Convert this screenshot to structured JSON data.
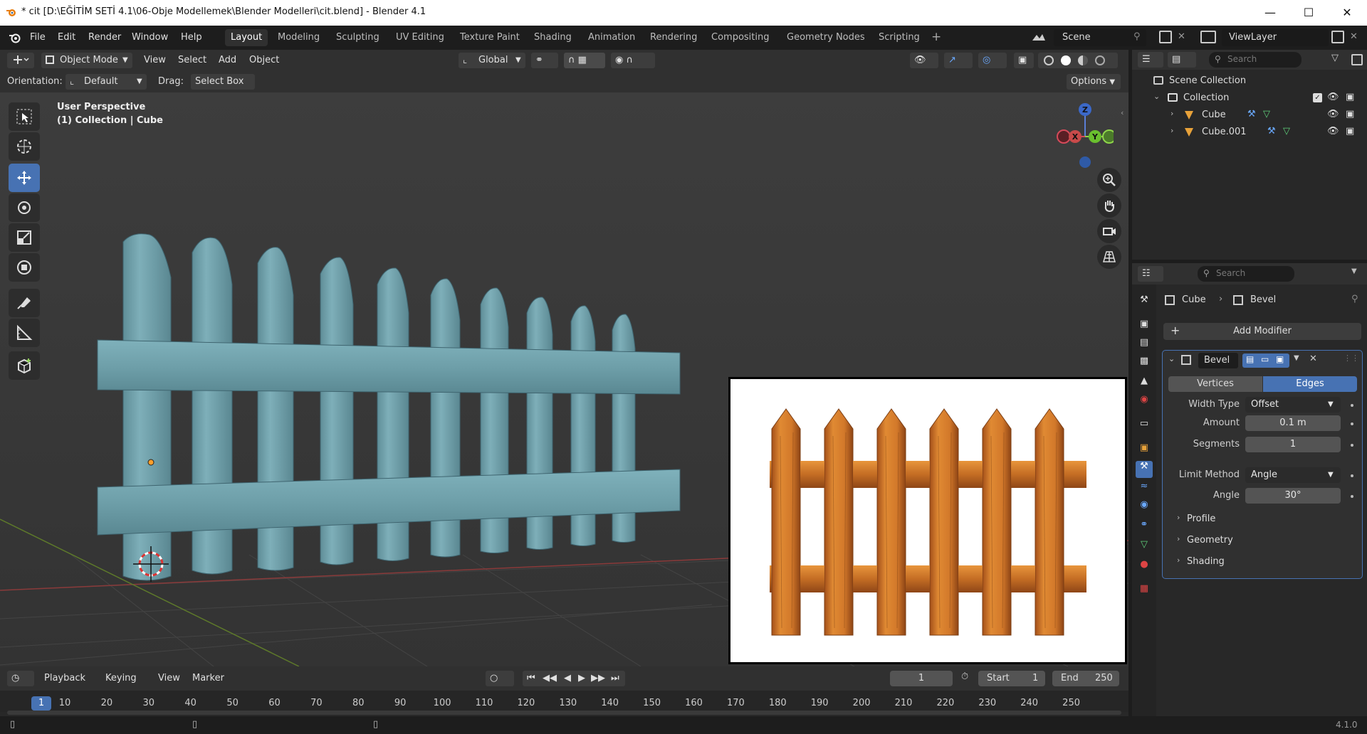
{
  "window": {
    "title": "* cit [D:\\EĞİTİM SETİ 4.1\\06-Obje Modellemek\\Blender Modelleri\\cit.blend] - Blender 4.1"
  },
  "menus": [
    "File",
    "Edit",
    "Render",
    "Window",
    "Help"
  ],
  "workspaces": [
    "Layout",
    "Modeling",
    "Sculpting",
    "UV Editing",
    "Texture Paint",
    "Shading",
    "Animation",
    "Rendering",
    "Compositing",
    "Geometry Nodes",
    "Scripting"
  ],
  "scene": {
    "name": "Scene",
    "view_layer": "ViewLayer"
  },
  "viewport_header": {
    "mode": "Object Mode",
    "menus": [
      "View",
      "Select",
      "Add",
      "Object"
    ],
    "transform_orientation": "Global"
  },
  "tool_settings": {
    "orientation_label": "Orientation:",
    "orientation_value": "Default",
    "drag_label": "Drag:",
    "drag_value": "Select Box",
    "options": "Options"
  },
  "viewport": {
    "perspective": "User Perspective",
    "context": "(1) Collection | Cube",
    "gizmo": {
      "x": "X",
      "y": "Y",
      "z": "Z"
    }
  },
  "outliner": {
    "search_placeholder": "Search",
    "scene_collection": "Scene Collection",
    "collection": "Collection",
    "objects": [
      "Cube",
      "Cube.001"
    ]
  },
  "properties": {
    "search_placeholder": "Search",
    "breadcrumb_object": "Cube",
    "breadcrumb_modifier": "Bevel",
    "add_modifier": "Add Modifier",
    "modifier_name": "Bevel",
    "tabs": {
      "vertices": "Vertices",
      "edges": "Edges"
    },
    "fields": {
      "width_type_label": "Width Type",
      "width_type": "Offset",
      "amount_label": "Amount",
      "amount": "0.1 m",
      "segments_label": "Segments",
      "segments": "1",
      "limit_method_label": "Limit Method",
      "limit_method": "Angle",
      "angle_label": "Angle",
      "angle": "30°"
    },
    "subpanels": [
      "Profile",
      "Geometry",
      "Shading"
    ]
  },
  "timeline": {
    "menus": [
      "Playback",
      "Keying",
      "View",
      "Marker"
    ],
    "current_frame": "1",
    "start_label": "Start",
    "start": "1",
    "end_label": "End",
    "end": "250",
    "ruler": [
      "1",
      "10",
      "20",
      "30",
      "40",
      "50",
      "60",
      "70",
      "80",
      "90",
      "100",
      "110",
      "120",
      "130",
      "140",
      "150",
      "160",
      "170",
      "180",
      "190",
      "200",
      "210",
      "220",
      "230",
      "240",
      "250"
    ]
  },
  "status": {
    "version": "4.1.0"
  },
  "colors": {
    "accent": "#4772b3",
    "fence": "#6f9ea8",
    "wood": "#c8701e"
  }
}
